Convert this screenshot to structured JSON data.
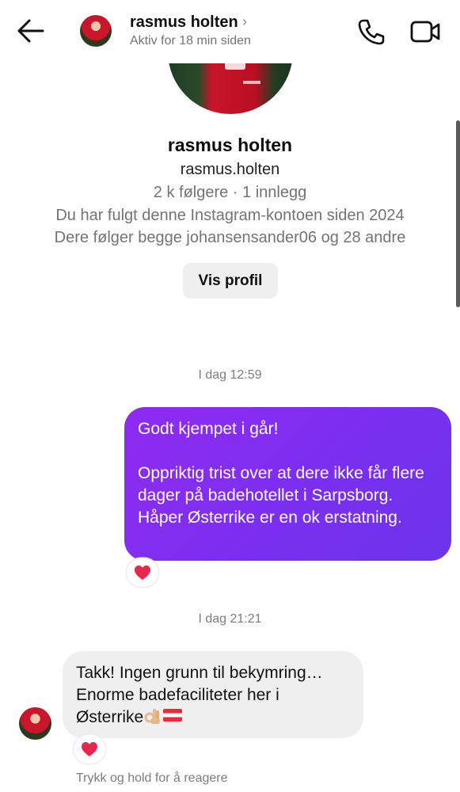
{
  "header": {
    "name": "rasmus holten",
    "chevron": "›",
    "status": "Aktiv for 18 min siden",
    "back_icon": "arrow-left-icon",
    "call_icon": "phone-icon",
    "video_icon": "video-camera-icon"
  },
  "profile": {
    "name": "rasmus holten",
    "username": "rasmus.holten",
    "stats": "2 k følgere · 1 innlegg",
    "followed_since": "Du har fulgt denne Instagram-kontoen siden 2024",
    "mutual": "Dere følger begge johansensander06 og 28 andre",
    "view_button": "Vis profil"
  },
  "messages": [
    {
      "timestamp": "I dag 12:59",
      "direction": "outgoing",
      "text": "Godt kjempet i går!\n\nOppriktig trist over at dere ikke får flere dager på badehotellet i Sarpsborg. Håper Østerrike er en ok erstatning.",
      "reaction": "heart"
    },
    {
      "timestamp": "I dag 21:21",
      "direction": "incoming",
      "text": "Takk! Ingen grunn til bekymring…\nEnorme badefaciliteter her i\nØsterrike",
      "emojis": [
        "ok-hand",
        "austria-flag"
      ],
      "reaction": "heart"
    }
  ],
  "hint": "Trykk og hold for å reagere",
  "colors": {
    "outgoing_bubble": "#7f2ff0",
    "incoming_bubble": "#efefef",
    "heart": "#e8264e"
  }
}
